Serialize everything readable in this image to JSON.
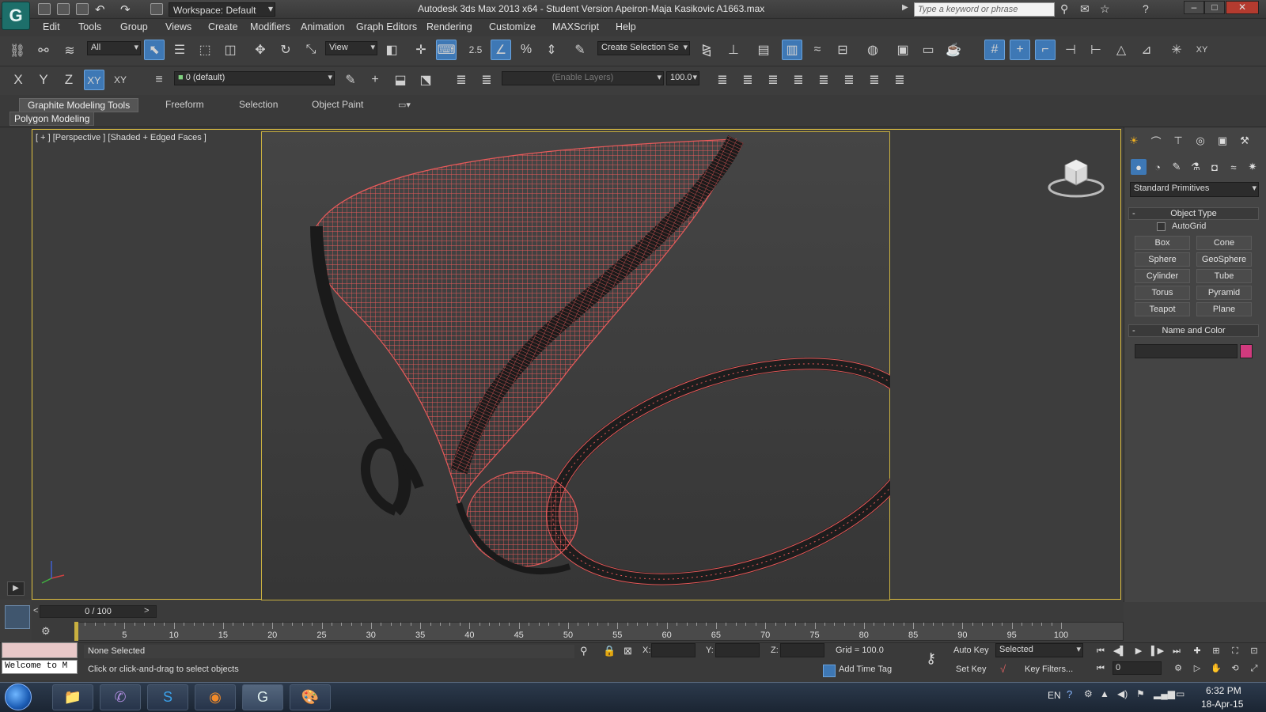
{
  "title_bar": {
    "workspace": "Workspace: Default",
    "window_title": "Autodesk 3ds Max  2013 x64  - Student Version    Apeiron-Maja Kasikovic A1663.max",
    "search_placeholder": "Type a keyword or phrase"
  },
  "menu": [
    "Edit",
    "Tools",
    "Group",
    "Views",
    "Create",
    "Modifiers",
    "Animation",
    "Graph Editors",
    "Rendering",
    "Customize",
    "MAXScript",
    "Help"
  ],
  "toolbar": {
    "selection_filter": "All",
    "reference_coord": "View",
    "snap_angle_label": "2.5",
    "named_selection_placeholder": "Create Selection Se"
  },
  "axis_constraints": [
    "X",
    "Y",
    "Z",
    "XY",
    "XY"
  ],
  "layer": {
    "current": "0 (default)",
    "layer_filter": "(Enable Layers)",
    "percent_value": "100.0"
  },
  "ribbon": {
    "tabs": [
      "Graphite Modeling Tools",
      "Freeform",
      "Selection",
      "Object Paint"
    ],
    "panel": "Polygon Modeling"
  },
  "viewport": {
    "label": "[ + ] [Perspective ] [Shaded + Edged Faces ]",
    "wire_color": "#e85a5a"
  },
  "command_panel": {
    "category": "Standard Primitives",
    "object_type_title": "Object Type",
    "autogrid": "AutoGrid",
    "primitives": [
      "Box",
      "Cone",
      "Sphere",
      "GeoSphere",
      "Cylinder",
      "Tube",
      "Torus",
      "Pyramid",
      "Teapot",
      "Plane"
    ],
    "name_color_title": "Name and Color",
    "object_color": "#d23a7e"
  },
  "timeline": {
    "slider": "0 / 100",
    "ticks": [
      "5",
      "10",
      "15",
      "20",
      "25",
      "30",
      "35",
      "40",
      "45",
      "50",
      "55",
      "60",
      "65",
      "70",
      "75",
      "80",
      "85",
      "90",
      "95",
      "100"
    ]
  },
  "status": {
    "mini_listener": "Welcome to M",
    "selection": "None Selected",
    "prompt": "Click or click-and-drag to select objects",
    "x_label": "X:",
    "y_label": "Y:",
    "z_label": "Z:",
    "grid": "Grid = 100.0",
    "add_time_tag": "Add Time Tag",
    "auto_key": "Auto Key",
    "set_key": "Set Key",
    "key_mode": "Selected",
    "key_filters": "Key Filters...",
    "frame": "0"
  },
  "taskbar": {
    "language": "EN",
    "time": "6:32 PM",
    "date": "18-Apr-15"
  }
}
